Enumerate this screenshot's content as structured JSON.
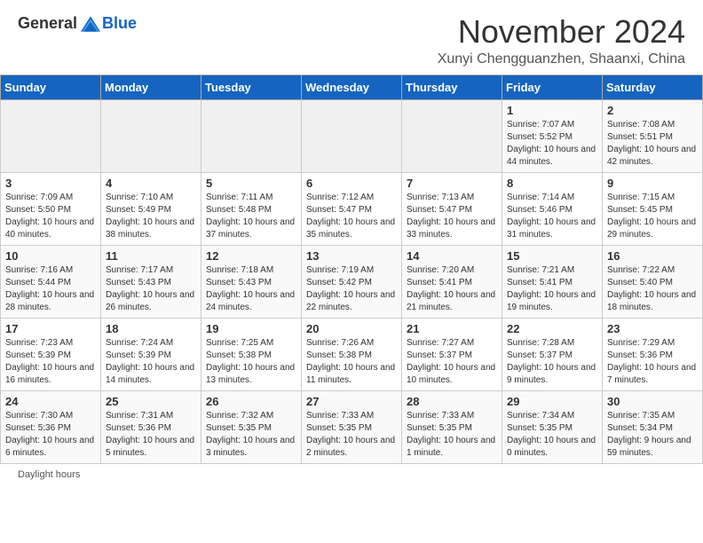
{
  "header": {
    "logo_general": "General",
    "logo_blue": "Blue",
    "month_title": "November 2024",
    "location": "Xunyi Chengguanzhen, Shaanxi, China"
  },
  "days_of_week": [
    "Sunday",
    "Monday",
    "Tuesday",
    "Wednesday",
    "Thursday",
    "Friday",
    "Saturday"
  ],
  "weeks": [
    [
      {
        "day": "",
        "info": ""
      },
      {
        "day": "",
        "info": ""
      },
      {
        "day": "",
        "info": ""
      },
      {
        "day": "",
        "info": ""
      },
      {
        "day": "",
        "info": ""
      },
      {
        "day": "1",
        "info": "Sunrise: 7:07 AM\nSunset: 5:52 PM\nDaylight: 10 hours and 44 minutes."
      },
      {
        "day": "2",
        "info": "Sunrise: 7:08 AM\nSunset: 5:51 PM\nDaylight: 10 hours and 42 minutes."
      }
    ],
    [
      {
        "day": "3",
        "info": "Sunrise: 7:09 AM\nSunset: 5:50 PM\nDaylight: 10 hours and 40 minutes."
      },
      {
        "day": "4",
        "info": "Sunrise: 7:10 AM\nSunset: 5:49 PM\nDaylight: 10 hours and 38 minutes."
      },
      {
        "day": "5",
        "info": "Sunrise: 7:11 AM\nSunset: 5:48 PM\nDaylight: 10 hours and 37 minutes."
      },
      {
        "day": "6",
        "info": "Sunrise: 7:12 AM\nSunset: 5:47 PM\nDaylight: 10 hours and 35 minutes."
      },
      {
        "day": "7",
        "info": "Sunrise: 7:13 AM\nSunset: 5:47 PM\nDaylight: 10 hours and 33 minutes."
      },
      {
        "day": "8",
        "info": "Sunrise: 7:14 AM\nSunset: 5:46 PM\nDaylight: 10 hours and 31 minutes."
      },
      {
        "day": "9",
        "info": "Sunrise: 7:15 AM\nSunset: 5:45 PM\nDaylight: 10 hours and 29 minutes."
      }
    ],
    [
      {
        "day": "10",
        "info": "Sunrise: 7:16 AM\nSunset: 5:44 PM\nDaylight: 10 hours and 28 minutes."
      },
      {
        "day": "11",
        "info": "Sunrise: 7:17 AM\nSunset: 5:43 PM\nDaylight: 10 hours and 26 minutes."
      },
      {
        "day": "12",
        "info": "Sunrise: 7:18 AM\nSunset: 5:43 PM\nDaylight: 10 hours and 24 minutes."
      },
      {
        "day": "13",
        "info": "Sunrise: 7:19 AM\nSunset: 5:42 PM\nDaylight: 10 hours and 22 minutes."
      },
      {
        "day": "14",
        "info": "Sunrise: 7:20 AM\nSunset: 5:41 PM\nDaylight: 10 hours and 21 minutes."
      },
      {
        "day": "15",
        "info": "Sunrise: 7:21 AM\nSunset: 5:41 PM\nDaylight: 10 hours and 19 minutes."
      },
      {
        "day": "16",
        "info": "Sunrise: 7:22 AM\nSunset: 5:40 PM\nDaylight: 10 hours and 18 minutes."
      }
    ],
    [
      {
        "day": "17",
        "info": "Sunrise: 7:23 AM\nSunset: 5:39 PM\nDaylight: 10 hours and 16 minutes."
      },
      {
        "day": "18",
        "info": "Sunrise: 7:24 AM\nSunset: 5:39 PM\nDaylight: 10 hours and 14 minutes."
      },
      {
        "day": "19",
        "info": "Sunrise: 7:25 AM\nSunset: 5:38 PM\nDaylight: 10 hours and 13 minutes."
      },
      {
        "day": "20",
        "info": "Sunrise: 7:26 AM\nSunset: 5:38 PM\nDaylight: 10 hours and 11 minutes."
      },
      {
        "day": "21",
        "info": "Sunrise: 7:27 AM\nSunset: 5:37 PM\nDaylight: 10 hours and 10 minutes."
      },
      {
        "day": "22",
        "info": "Sunrise: 7:28 AM\nSunset: 5:37 PM\nDaylight: 10 hours and 9 minutes."
      },
      {
        "day": "23",
        "info": "Sunrise: 7:29 AM\nSunset: 5:36 PM\nDaylight: 10 hours and 7 minutes."
      }
    ],
    [
      {
        "day": "24",
        "info": "Sunrise: 7:30 AM\nSunset: 5:36 PM\nDaylight: 10 hours and 6 minutes."
      },
      {
        "day": "25",
        "info": "Sunrise: 7:31 AM\nSunset: 5:36 PM\nDaylight: 10 hours and 5 minutes."
      },
      {
        "day": "26",
        "info": "Sunrise: 7:32 AM\nSunset: 5:35 PM\nDaylight: 10 hours and 3 minutes."
      },
      {
        "day": "27",
        "info": "Sunrise: 7:33 AM\nSunset: 5:35 PM\nDaylight: 10 hours and 2 minutes."
      },
      {
        "day": "28",
        "info": "Sunrise: 7:33 AM\nSunset: 5:35 PM\nDaylight: 10 hours and 1 minute."
      },
      {
        "day": "29",
        "info": "Sunrise: 7:34 AM\nSunset: 5:35 PM\nDaylight: 10 hours and 0 minutes."
      },
      {
        "day": "30",
        "info": "Sunrise: 7:35 AM\nSunset: 5:34 PM\nDaylight: 9 hours and 59 minutes."
      }
    ]
  ],
  "footer": {
    "daylight_label": "Daylight hours"
  }
}
